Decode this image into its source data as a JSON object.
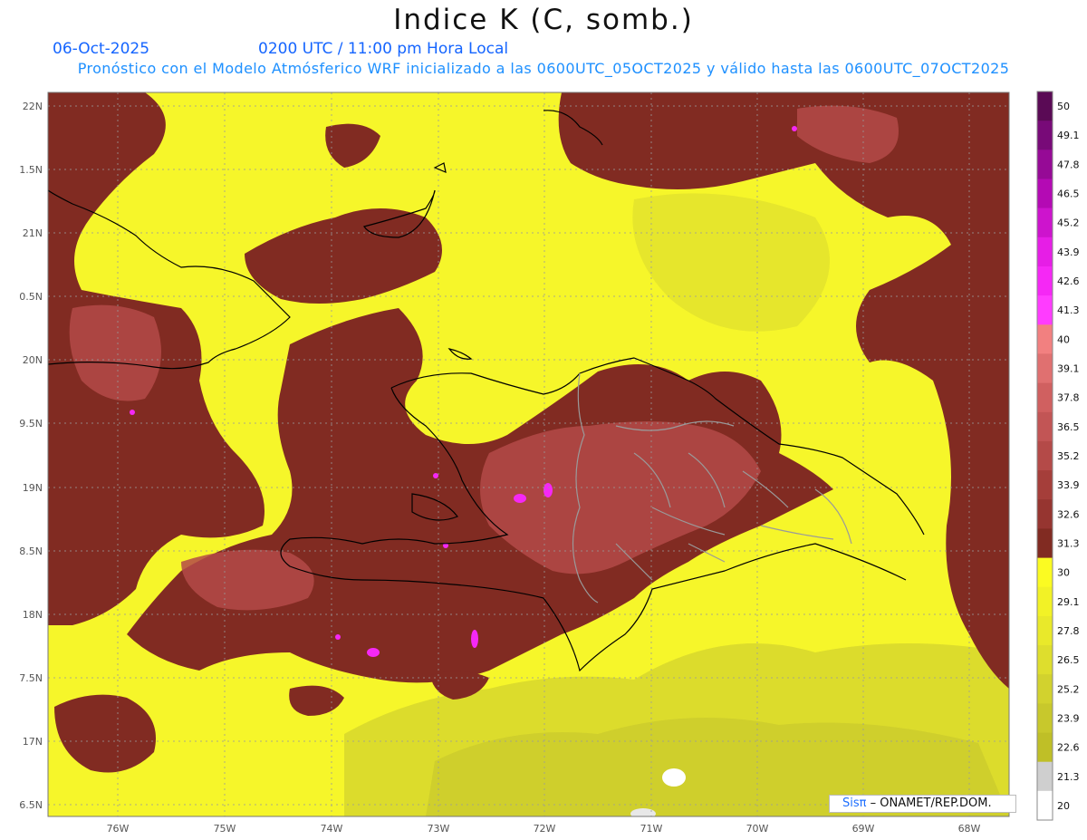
{
  "title": "Indice K (C, somb.)",
  "date_label": "06-Oct-2025",
  "time_label": "0200 UTC / 11:00 pm Hora Local",
  "subtitle": "Pronóstico con el Modelo Atmósferico WRF inicializado a las 0600UTC_05OCT2025 y válido hasta las  0600UTC_07OCT2025",
  "credit": {
    "logo": "Sisπ",
    "text": "– ONAMET/REP.DOM."
  },
  "map": {
    "lat_labels": [
      "22N",
      "1.5N",
      "21N",
      "0.5N",
      "20N",
      "9.5N",
      "19N",
      "8.5N",
      "18N",
      "7.5N",
      "17N",
      "6.5N"
    ],
    "lon_labels": [
      "76W",
      "75W",
      "74W",
      "73W",
      "72W",
      "71W",
      "70W",
      "69W",
      "68W"
    ]
  },
  "colorbar": {
    "labels": [
      "50",
      "49.1",
      "47.8",
      "46.5",
      "45.2",
      "43.9",
      "42.6",
      "41.3",
      "40",
      "39.1",
      "37.8",
      "36.5",
      "35.2",
      "33.9",
      "32.6",
      "31.3",
      "30",
      "29.1",
      "27.8",
      "26.5",
      "25.2",
      "23.9",
      "22.6",
      "21.3",
      "20"
    ],
    "colors": [
      "#5a0a55",
      "#780a78",
      "#960a96",
      "#b40ab4",
      "#cd14cd",
      "#e61ee6",
      "#f528f5",
      "#ff3cff",
      "#f28080",
      "#e07070",
      "#d06060",
      "#c25555",
      "#b44a48",
      "#a53e3a",
      "#963530",
      "#812b22",
      "#fbfb22",
      "#f2f226",
      "#e9e92a",
      "#dede2d",
      "#d2d22e",
      "#c8c82c",
      "#bfbf27",
      "#cfcfcf",
      "#ffffff"
    ]
  }
}
